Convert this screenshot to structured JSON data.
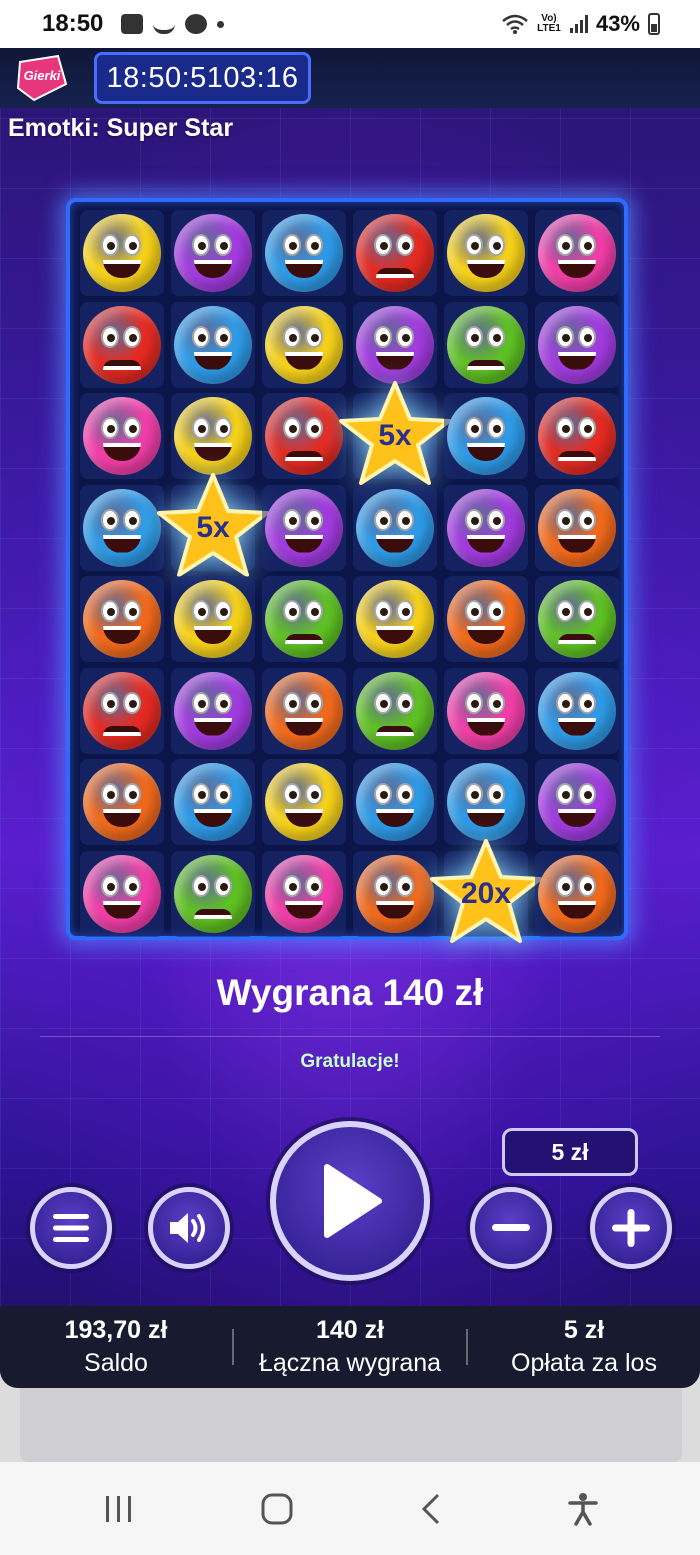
{
  "status_bar": {
    "time": "18:50",
    "battery": "43%",
    "network": "Vo) LTE1"
  },
  "app": {
    "brand": "Gierki",
    "clock": "18:50:5103:16",
    "title": "Emotki: Super Star"
  },
  "board": {
    "colors": {
      "yellow": "#f7d21a",
      "purple": "#a23be0",
      "blue": "#2e9be8",
      "red": "#e52a22",
      "pink": "#f23ea8",
      "green": "#5fc123",
      "orange": "#f26a1c"
    },
    "rows": [
      [
        "yellow",
        "purple",
        "blue",
        "red",
        "yellow",
        "pink"
      ],
      [
        "red",
        "blue",
        "yellow",
        "purple",
        "green",
        "purple"
      ],
      [
        "pink",
        "yellow",
        "red",
        "star",
        "blue",
        "red"
      ],
      [
        "blue",
        "star",
        "purple",
        "blue",
        "purple",
        "orange"
      ],
      [
        "orange",
        "yellow",
        "green",
        "yellow",
        "orange",
        "green"
      ],
      [
        "red",
        "purple",
        "orange",
        "green",
        "pink",
        "blue"
      ],
      [
        "orange",
        "blue",
        "yellow",
        "blue",
        "blue",
        "purple"
      ],
      [
        "pink",
        "green",
        "pink",
        "orange",
        "star",
        "orange"
      ]
    ],
    "multipliers": [
      "5x",
      "5x",
      "20x"
    ]
  },
  "result": {
    "win_text": "Wygrana 140 zł",
    "message": "Gratulacje!"
  },
  "controls": {
    "bet": "5 zł",
    "menu_icon": "hamburger-icon",
    "sound_icon": "speaker-icon",
    "play_icon": "play-icon",
    "minus_icon": "minus-icon",
    "plus_icon": "plus-icon"
  },
  "footer": {
    "balance_value": "193,70 zł",
    "balance_label": "Saldo",
    "total_win_value": "140 zł",
    "total_win_label": "Łączna wygrana",
    "fee_value": "5 zł",
    "fee_label": "Opłata za los"
  }
}
